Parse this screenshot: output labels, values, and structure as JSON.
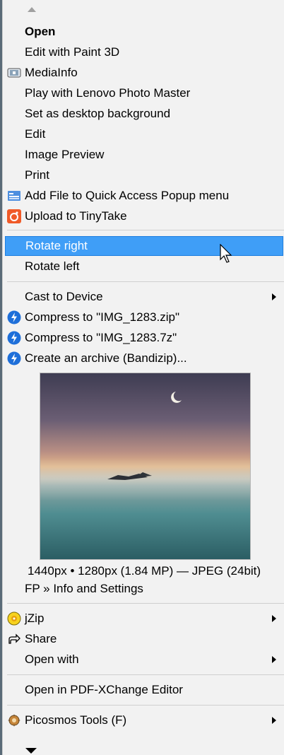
{
  "menu": {
    "items": [
      {
        "label": "Open"
      },
      {
        "label": "Edit with Paint 3D"
      },
      {
        "label": "MediaInfo",
        "icon": "mediainfo-icon"
      },
      {
        "label": "Play with Lenovo Photo Master"
      },
      {
        "label": "Set as desktop background"
      },
      {
        "label": "Edit"
      },
      {
        "label": "Image Preview"
      },
      {
        "label": "Print"
      },
      {
        "label": "Add File to Quick Access Popup menu",
        "icon": "quick-access-icon"
      },
      {
        "label": "Upload to TinyTake",
        "icon": "tinytake-icon"
      },
      {
        "label": "Rotate right"
      },
      {
        "label": "Rotate left"
      },
      {
        "label": "Cast to Device"
      },
      {
        "label": "Compress to \"IMG_1283.zip\"",
        "icon": "bandizip-icon"
      },
      {
        "label": "Compress to \"IMG_1283.7z\"",
        "icon": "bandizip-icon"
      },
      {
        "label": "Create an archive (Bandizip)...",
        "icon": "bandizip-icon"
      },
      {
        "label": "jZip",
        "icon": "jzip-icon"
      },
      {
        "label": "Share",
        "icon": "share-icon"
      },
      {
        "label": "Open with"
      },
      {
        "label": "Open in PDF-XChange Editor"
      },
      {
        "label": "Picosmos Tools (F)",
        "icon": "picosmos-icon"
      }
    ]
  },
  "preview": {
    "info": "1440px • 1280px (1.84 MP) — JPEG (24bit)",
    "settings": "FP » Info and Settings"
  },
  "colors": {
    "highlight": "#3f9ef7",
    "bandizip": "#1e6fd9",
    "tinytake": "#f05a28"
  }
}
